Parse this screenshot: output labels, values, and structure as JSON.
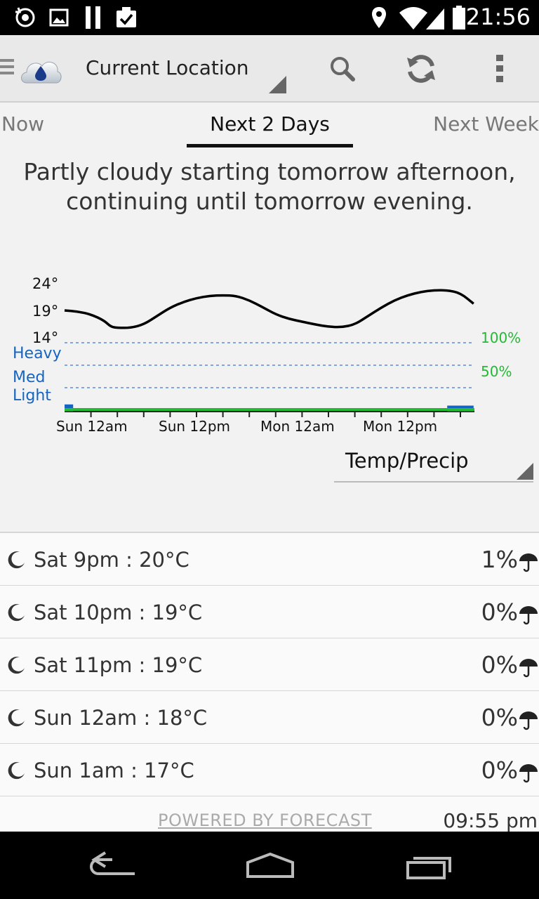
{
  "status_bar": {
    "time": "21:56",
    "left_icons": [
      "sync-icon",
      "image-icon",
      "pause-icon",
      "clipboard-check-icon"
    ],
    "right_icons": [
      "location-icon",
      "wifi-icon",
      "signal-icon",
      "battery-icon"
    ]
  },
  "action_bar": {
    "location": "Current Location",
    "icons": [
      "menu-icon",
      "app-logo-icon",
      "search-icon",
      "refresh-icon",
      "overflow-menu-icon"
    ]
  },
  "tabs": [
    {
      "label": "Now",
      "selected": false
    },
    {
      "label": "Next 2 Days",
      "selected": true
    },
    {
      "label": "Next Week",
      "selected": false
    }
  ],
  "summary": "Partly cloudy starting tomorrow afternoon, continuing until tomorrow evening.",
  "chart_data": {
    "type": "line",
    "x_ticks": [
      "Sun 12am",
      "Sun 12pm",
      "Mon 12am",
      "Mon 12pm"
    ],
    "temp_axis": [
      "24°",
      "19°",
      "14°"
    ],
    "precip_intensity_labels": [
      "Heavy",
      "Med",
      "Light"
    ],
    "precip_prob_labels": [
      "100%",
      "50%"
    ],
    "temperature_series": [
      {
        "t": 0,
        "temp": 19
      },
      {
        "t": 2,
        "temp": 18.8
      },
      {
        "t": 4,
        "temp": 18.3
      },
      {
        "t": 6,
        "temp": 17.2
      },
      {
        "t": 7,
        "temp": 16.1
      },
      {
        "t": 8,
        "temp": 15.9
      },
      {
        "t": 10,
        "temp": 15.9
      },
      {
        "t": 12,
        "temp": 16.5
      },
      {
        "t": 14,
        "temp": 18
      },
      {
        "t": 16,
        "temp": 19.5
      },
      {
        "t": 18,
        "temp": 20.5
      },
      {
        "t": 20,
        "temp": 21.2
      },
      {
        "t": 22,
        "temp": 21.6
      },
      {
        "t": 24,
        "temp": 21.7
      },
      {
        "t": 26,
        "temp": 21.6
      },
      {
        "t": 28,
        "temp": 20.8
      },
      {
        "t": 30,
        "temp": 19.6
      },
      {
        "t": 32,
        "temp": 18.3
      },
      {
        "t": 34,
        "temp": 17.5
      },
      {
        "t": 36,
        "temp": 17
      },
      {
        "t": 38,
        "temp": 16.5
      },
      {
        "t": 40,
        "temp": 16.1
      },
      {
        "t": 42,
        "temp": 16
      },
      {
        "t": 44,
        "temp": 16.5
      },
      {
        "t": 46,
        "temp": 18
      },
      {
        "t": 48,
        "temp": 19.5
      },
      {
        "t": 50,
        "temp": 20.8
      },
      {
        "t": 52,
        "temp": 21.7
      },
      {
        "t": 54,
        "temp": 22.3
      },
      {
        "t": 56,
        "temp": 22.6
      },
      {
        "t": 58,
        "temp": 22.6
      },
      {
        "t": 60,
        "temp": 22.1
      },
      {
        "t": 62,
        "temp": 20.2
      }
    ],
    "precip_bars": [
      {
        "t_start": 0,
        "t_end": 1.3,
        "intensity": 0.3
      },
      {
        "t_start": 58,
        "t_end": 62,
        "intensity": 0.25
      }
    ],
    "precip_probability": 0.01,
    "colors": {
      "temp_line": "#000000",
      "precip": "#1565c0",
      "probability": "#22bb33",
      "grid": "#5b8fd8"
    }
  },
  "view_selector": {
    "selected": "Temp/Precip"
  },
  "hourly": [
    {
      "label": "Sat 9pm : 20°C",
      "precip": "1%"
    },
    {
      "label": "Sat 10pm : 19°C",
      "precip": "0%"
    },
    {
      "label": "Sat 11pm : 19°C",
      "precip": "0%"
    },
    {
      "label": "Sun 12am : 18°C",
      "precip": "0%"
    },
    {
      "label": "Sun 1am : 17°C",
      "precip": "0%"
    }
  ],
  "footer": {
    "powered_by": "POWERED BY FORECAST",
    "updated": "09:55 pm"
  },
  "nav_bar": {
    "icons": [
      "back-icon",
      "home-icon",
      "recents-icon"
    ]
  }
}
